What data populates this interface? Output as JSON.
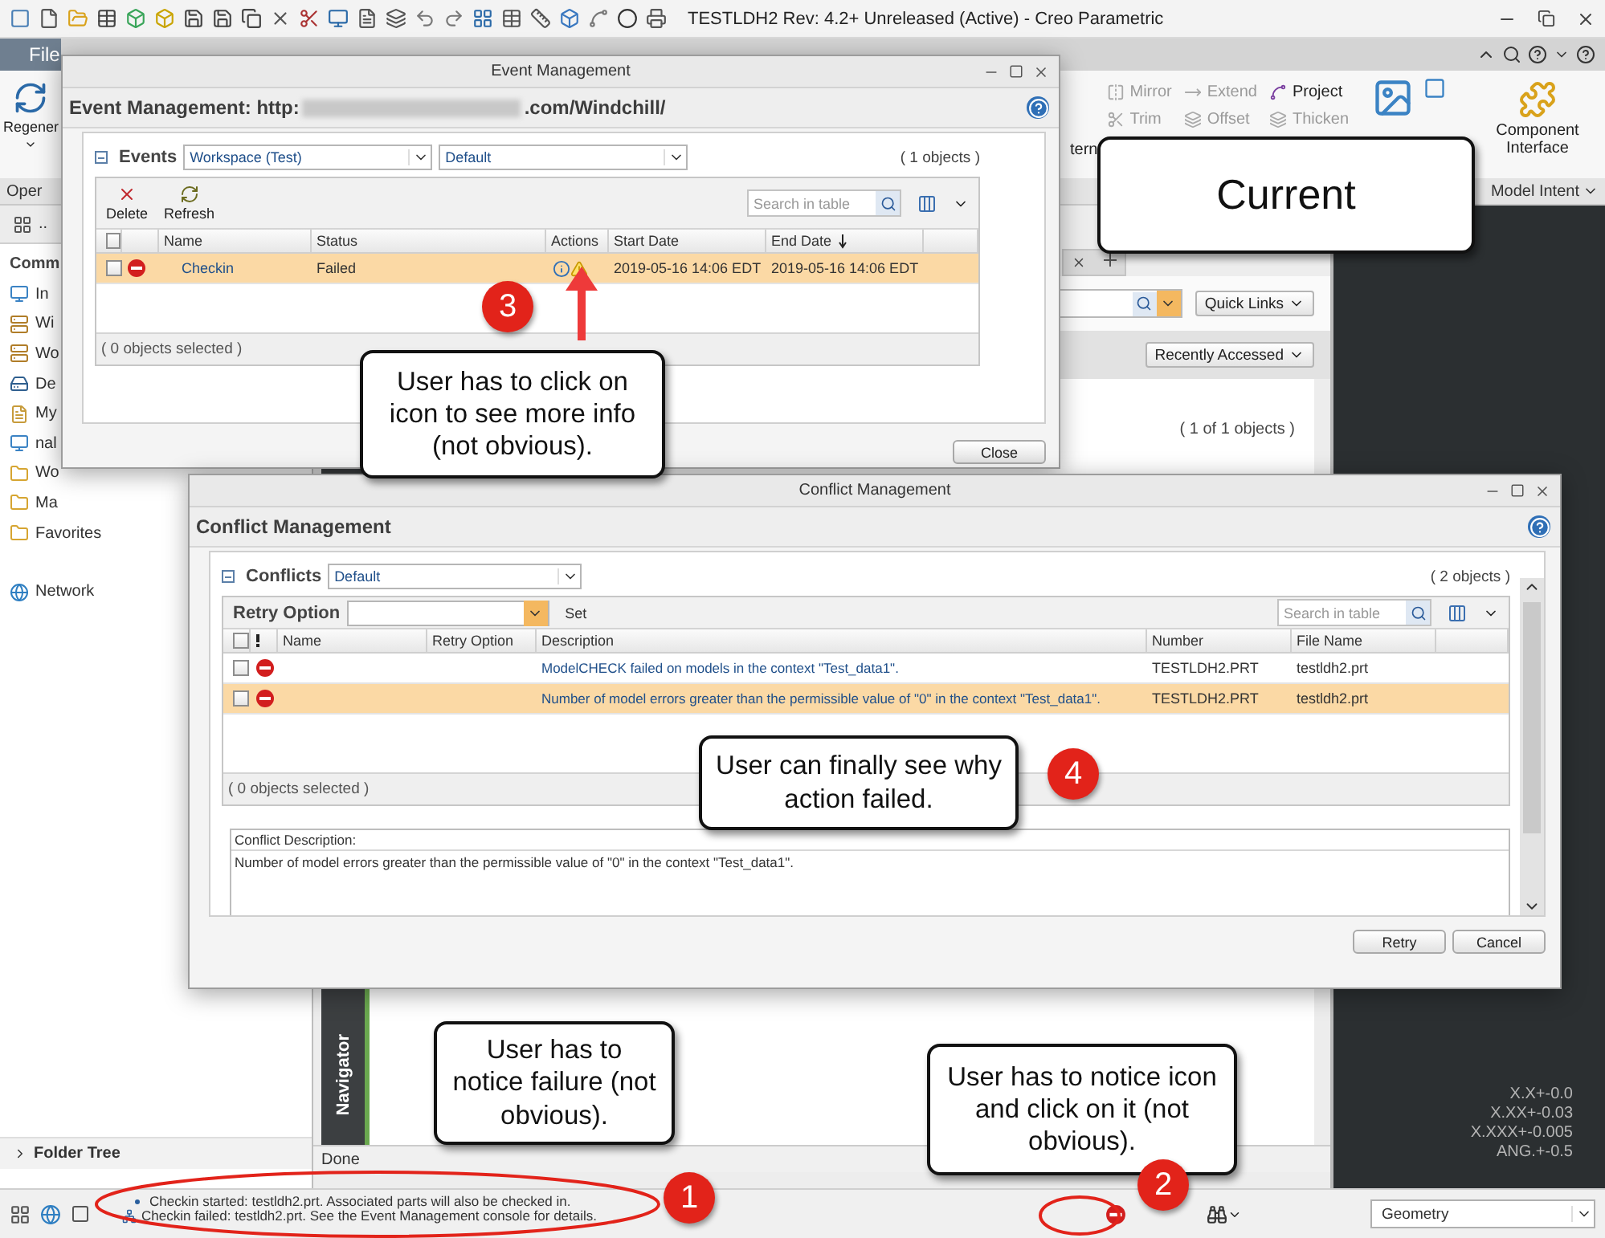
{
  "app": {
    "title": "TESTLDH2 Rev: 4.2+ Unreleased  (Active) - Creo Parametric"
  },
  "ribbon": {
    "file_tab": "File",
    "left_button": "Regener",
    "left_group": "Oper",
    "pattern_fragment": "tern",
    "tools": [
      {
        "label": "Mirror",
        "disabled": true
      },
      {
        "label": "Extend",
        "disabled": true
      },
      {
        "label": "Project",
        "disabled": false
      },
      {
        "label": "Trim",
        "disabled": true
      },
      {
        "label": "Offset",
        "disabled": true
      },
      {
        "label": "Thicken",
        "disabled": true
      }
    ],
    "component_button": "Component Interface",
    "right_group": "Model Intent"
  },
  "sidebar": {
    "toolbar_label": "..",
    "header": "Comm",
    "items": [
      {
        "kind": "computer",
        "label": "In"
      },
      {
        "kind": "server",
        "label": "Wi"
      },
      {
        "kind": "server",
        "label": "Wo"
      },
      {
        "kind": "desktop",
        "label": "De"
      },
      {
        "kind": "documents",
        "label": "My"
      },
      {
        "kind": "computer",
        "label": "nal"
      },
      {
        "kind": "folder",
        "label": "Wo"
      },
      {
        "kind": "folder",
        "label": "Ma"
      },
      {
        "kind": "folder",
        "label": "Favorites"
      },
      {
        "kind": "network",
        "label": "Network"
      }
    ],
    "folder_tree": "Folder Tree"
  },
  "browser": {
    "quick_links": "Quick Links",
    "recently_accessed": "Recently Accessed",
    "count": "( 1 of 1 objects )",
    "navigator": "Navigator",
    "status": "Done"
  },
  "graphics": {
    "tolerances": [
      "X.X+-0.0",
      "X.XX+-0.03",
      "X.XXX+-0.005",
      "ANG.+-0.5"
    ]
  },
  "event_window": {
    "title": "Event Management",
    "header_prefix": "Event Management: http:",
    "header_suffix": ".com/Windchill/",
    "table_title": "Events",
    "view_select": "Workspace (Test)",
    "filter_select": "Default",
    "count": "( 1 objects )",
    "actions": [
      {
        "kind": "delete",
        "label": "Delete"
      },
      {
        "kind": "refresh",
        "label": "Refresh"
      }
    ],
    "search_placeholder": "Search in table",
    "all_checked": false,
    "columns": [
      "Name",
      "Status",
      "Actions",
      "Start Date",
      "End Date"
    ],
    "rows": [
      {
        "checked": false,
        "selected": true,
        "name": "Checkin",
        "status": "Failed",
        "start": "2019-05-16 14:06 EDT",
        "end": "2019-05-16 14:06 EDT"
      }
    ],
    "footer": "( 0 objects selected )",
    "close_button": "Close"
  },
  "conflict_window": {
    "title": "Conflict Management",
    "header": "Conflict Management",
    "table_title": "Conflicts",
    "filter_select": "Default",
    "count": "( 2 objects )",
    "retry_label": "Retry Option",
    "set_button": "Set",
    "search_placeholder": "Search in table",
    "all_checked": false,
    "columns": [
      "Name",
      "Retry Option",
      "Description",
      "Number",
      "File Name"
    ],
    "rows": [
      {
        "checked": false,
        "selected": false,
        "description": "ModelCHECK failed on models in the context \"Test_data1\".",
        "number": "TESTLDH2.PRT",
        "file": "testldh2.prt"
      },
      {
        "checked": false,
        "selected": true,
        "description": "Number of model errors greater than the permissible value of \"0\" in the context \"Test_data1\".",
        "number": "TESTLDH2.PRT",
        "file": "testldh2.prt"
      }
    ],
    "footer": "( 0 objects selected )",
    "description_label": "Conflict Description:",
    "description_text": "Number of model errors greater than the permissible value of \"0\" in the context \"Test_data1\".",
    "buttons": [
      "Retry",
      "Cancel"
    ]
  },
  "status_bar": {
    "messages": [
      {
        "kind": "info",
        "text": "Checkin started: testldh2.prt. Associated parts will also be checked in."
      },
      {
        "kind": "error",
        "text": "Checkin failed: testldh2.prt. See the Event Management console for details."
      }
    ],
    "filter": "Geometry"
  },
  "annotations": {
    "callouts": [
      "Current",
      "User has to click on icon to see more info (not obvious).",
      "User can finally see why action failed.",
      "User has to notice failure (not obvious).",
      "User has to notice icon and click on it (not obvious)."
    ],
    "markers": [
      "3",
      "4",
      "1",
      "2"
    ]
  }
}
